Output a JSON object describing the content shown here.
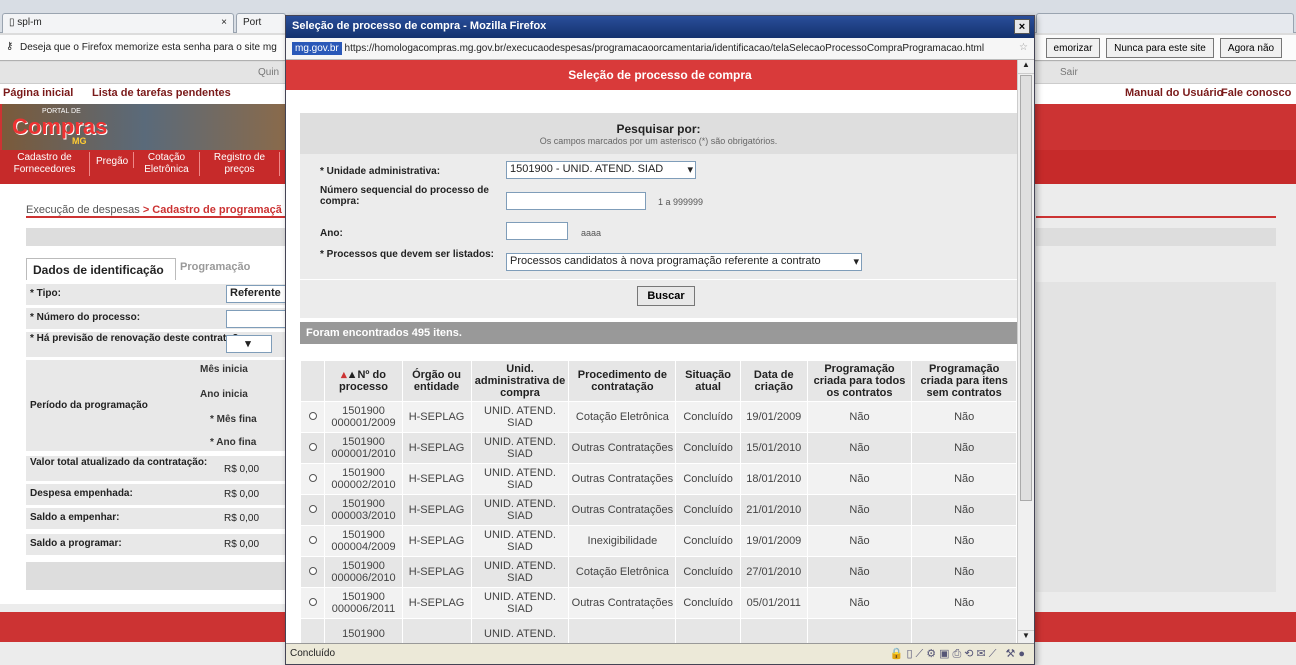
{
  "bg_browser": {
    "tabs": [
      "spl-m",
      "Port"
    ],
    "password_prompt": "Deseja que o Firefox memorize esta senha para o site mg",
    "pwd_buttons": [
      "emorizar",
      "Nunca para este site",
      "Agora não"
    ],
    "strip_left": "Quin",
    "strip_right": "Sair"
  },
  "site": {
    "nav_left": [
      "Página inicial",
      "Lista de tarefas pendentes"
    ],
    "nav_right": [
      "Manual do Usuário",
      "Fale conosco"
    ],
    "logo_text": "Compras",
    "logo_sub": "PORTAL DE",
    "logo_mg": "MG",
    "menu": [
      "Cadastro de Fornecedores",
      "Pregão",
      "Cotação Eletrônica",
      "Registro de preços"
    ],
    "breadcrumb_a": "Execução de despesas",
    "breadcrumb_b": "> Cadastro de programaçã",
    "tabs": [
      "Dados de identificação",
      "Programação"
    ],
    "rows": [
      {
        "label": "* Tipo:",
        "value": "Referente"
      },
      {
        "label": "* Número do processo:",
        "value": ""
      },
      {
        "label": "* Há previsão de renovação deste contrato?",
        "value": ""
      },
      {
        "label": "Período da programação",
        "value": ""
      },
      {
        "label": "Valor total atualizado da contratação:",
        "value": "R$ 0,00"
      },
      {
        "label": "Despesa empenhada:",
        "value": "R$ 0,00"
      },
      {
        "label": "Saldo a empenhar:",
        "value": "R$ 0,00"
      },
      {
        "label": "Saldo a programar:",
        "value": "R$ 0,00"
      }
    ],
    "period_fields": [
      "Mês inicia",
      "Ano inicia",
      "* Mês fina",
      "* Ano fina"
    ]
  },
  "popup": {
    "title": "Seleção de processo de compra - Mozilla Firefox",
    "url_domain": "mg.gov.br",
    "url": "https://homologacompras.mg.gov.br/execucaodespesas/programacaoorcamentaria/identificacao/telaSelecaoProcessoCompraProgramacao.html",
    "header": "Seleção de processo de compra",
    "search_title": "Pesquisar por:",
    "search_note": "Os campos marcados por um asterisco (*) são obrigatórios.",
    "fields": {
      "unidade_label": "* Unidade administrativa:",
      "unidade_value": "1501900 - UNID. ATEND. SIAD",
      "numero_label": "Número sequencial do processo de compra:",
      "numero_hint": "1 a 999999",
      "ano_label": "Ano:",
      "ano_hint": "aaaa",
      "processos_label": "* Processos que devem ser listados:",
      "processos_value": "Processos candidatos à nova programação referente a contrato"
    },
    "search_button": "Buscar",
    "found_text": "Foram encontrados 495 itens.",
    "columns": [
      "▲Nº do processo",
      "Órgão ou entidade",
      "Unid. administrativa de compra",
      "Procedimento de contratação",
      "Situação atual",
      "Data de criação",
      "Programação criada para todos os contratos",
      "Programação criada para itens sem contratos"
    ],
    "rows": [
      [
        "1501900 000001/2009",
        "H-SEPLAG",
        "UNID. ATEND. SIAD",
        "Cotação Eletrônica",
        "Concluído",
        "19/01/2009",
        "Não",
        "Não"
      ],
      [
        "1501900 000001/2010",
        "H-SEPLAG",
        "UNID. ATEND. SIAD",
        "Outras Contratações",
        "Concluído",
        "15/01/2010",
        "Não",
        "Não"
      ],
      [
        "1501900 000002/2010",
        "H-SEPLAG",
        "UNID. ATEND. SIAD",
        "Outras Contratações",
        "Concluído",
        "18/01/2010",
        "Não",
        "Não"
      ],
      [
        "1501900 000003/2010",
        "H-SEPLAG",
        "UNID. ATEND. SIAD",
        "Outras Contratações",
        "Concluído",
        "21/01/2010",
        "Não",
        "Não"
      ],
      [
        "1501900 000004/2009",
        "H-SEPLAG",
        "UNID. ATEND. SIAD",
        "Inexigibilidade",
        "Concluído",
        "19/01/2009",
        "Não",
        "Não"
      ],
      [
        "1501900 000006/2010",
        "H-SEPLAG",
        "UNID. ATEND. SIAD",
        "Cotação Eletrônica",
        "Concluído",
        "27/01/2010",
        "Não",
        "Não"
      ],
      [
        "1501900 000006/2011",
        "H-SEPLAG",
        "UNID. ATEND. SIAD",
        "Outras Contratações",
        "Concluído",
        "05/01/2011",
        "Não",
        "Não"
      ],
      [
        "1501900",
        "",
        "UNID. ATEND.",
        "",
        "",
        "",
        "",
        ""
      ]
    ],
    "status": "Concluído"
  }
}
